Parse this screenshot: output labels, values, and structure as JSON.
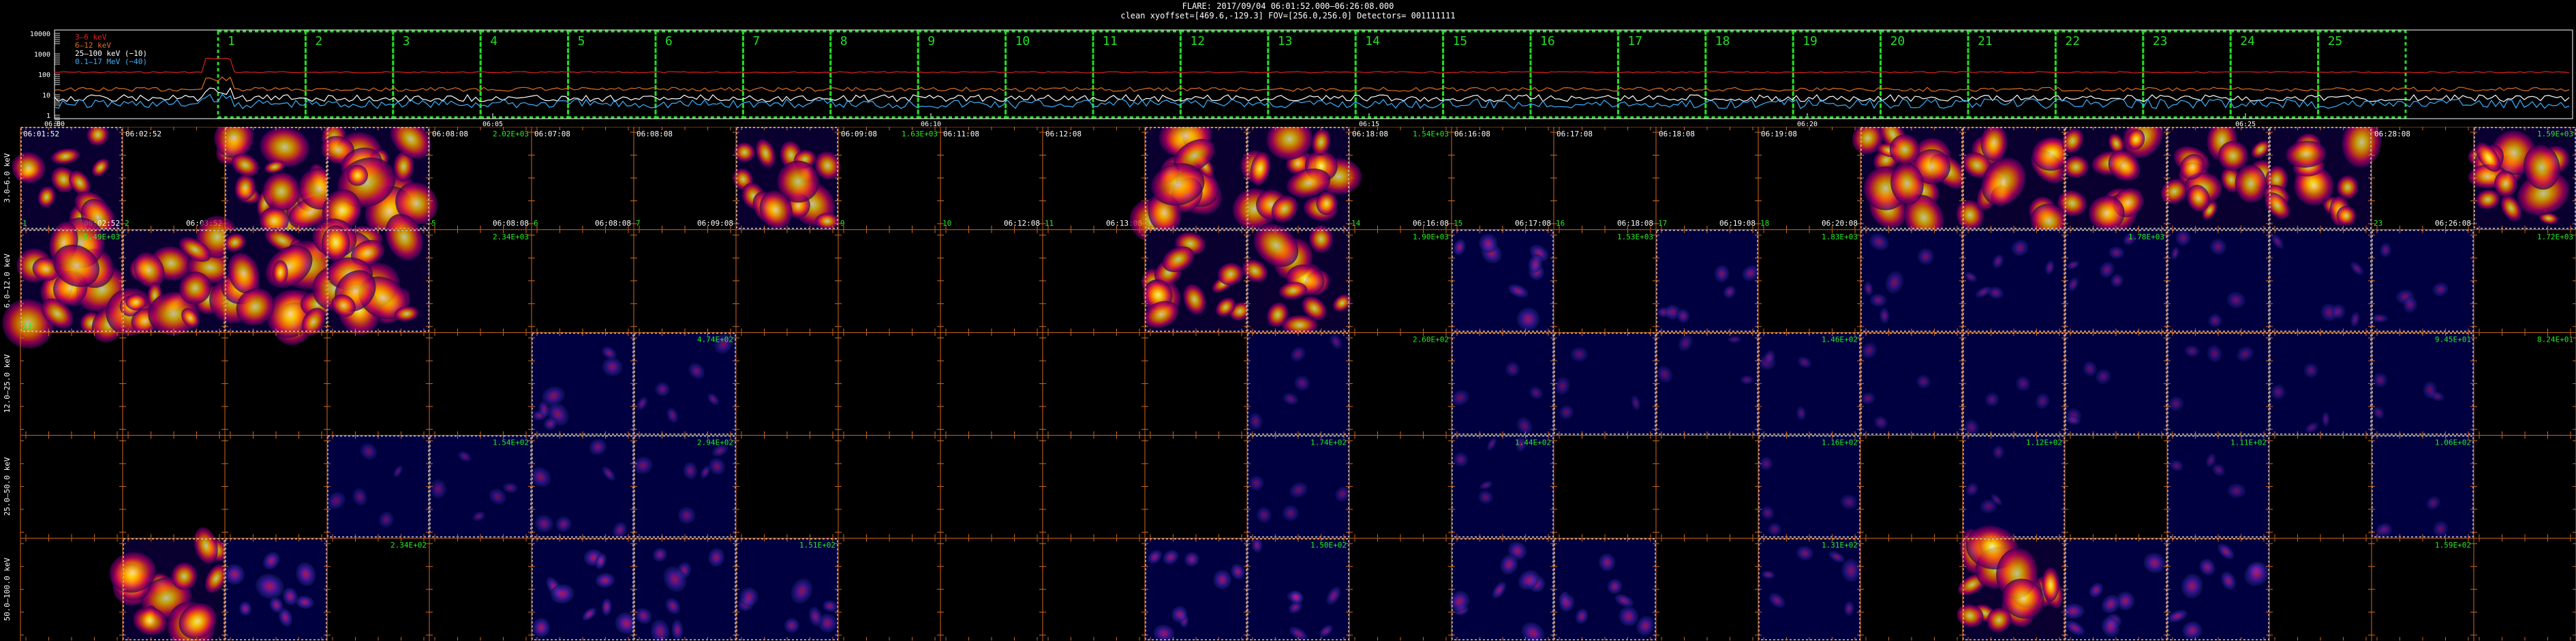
{
  "header": {
    "line1": "FLARE: 2017/09/04 06:01:52.000–06:26:08.000",
    "line2": "clean   xyoffset=[469.6,-129.3]   FOV=[256.0,256.0]   Detectors= 001111111"
  },
  "lightcurve": {
    "yticks": [
      "10000",
      "1000",
      "100",
      "10",
      "1"
    ],
    "xticks": [
      "06:00",
      "06:05",
      "06:10",
      "06:15",
      "06:20",
      "06:25"
    ],
    "legend": [
      {
        "text": "3–6 keV",
        "color": "#e02020"
      },
      {
        "text": "6–12 keV",
        "color": "#e07020"
      },
      {
        "text": "25–100 keV (−10)",
        "color": "#ffffff"
      },
      {
        "text": "0.1–17 MeV (−40)",
        "color": "#3ab0ff"
      }
    ],
    "intervals": [
      "1",
      "2",
      "3",
      "4",
      "5",
      "6",
      "7",
      "8",
      "9",
      "10",
      "11",
      "12",
      "13",
      "14",
      "15",
      "16",
      "17",
      "18",
      "19",
      "20",
      "21",
      "22",
      "23",
      "24",
      "25"
    ]
  },
  "grid": {
    "rows": [
      {
        "label": "3.0–6.0 keV",
        "cells": [
          {
            "img": "fire",
            "tl": "06:01:52",
            "br": "06:02:52",
            "bl": "1"
          },
          {
            "img": "none",
            "tl": "06:02:52",
            "br": "06:03:52",
            "bl": "2"
          },
          {
            "img": "fire",
            "intensity": 1.0,
            "bl": ""
          },
          {
            "img": "fire",
            "intensity": 0.9,
            "bl": ""
          },
          {
            "img": "none",
            "tl": "06:08:08",
            "tr": "2.02E+03",
            "br": "06:08:08",
            "bl": "5"
          },
          {
            "img": "none",
            "tl": "06:07:08",
            "br": "06:08:08",
            "bl": "6"
          },
          {
            "img": "none",
            "tl": "06:08:08",
            "br": "06:09:08",
            "bl": "7"
          },
          {
            "img": "fire",
            "intensity": 0.8,
            "bl": ""
          },
          {
            "img": "none",
            "tl": "06:09:08",
            "tr": "1.63E+03",
            "bl": "9"
          },
          {
            "img": "none",
            "tl": "06:11:08",
            "br": "06:12:08",
            "bl": "10"
          },
          {
            "img": "none",
            "tl": "06:12:08",
            "br": "06:13:08",
            "bl": "11"
          },
          {
            "img": "fire",
            "intensity": 0.85,
            "bl": ""
          },
          {
            "img": "fire",
            "intensity": 0.85,
            "bl": ""
          },
          {
            "img": "none",
            "tl": "06:18:08",
            "tr": "1.54E+03",
            "br": "06:16:08",
            "bl": "14"
          },
          {
            "img": "none",
            "tl": "06:16:08",
            "br": "06:17:08",
            "bl": "15"
          },
          {
            "img": "none",
            "tl": "06:17:08",
            "br": "06:18:08",
            "bl": "16"
          },
          {
            "img": "none",
            "tl": "06:18:08",
            "br": "06:19:08",
            "bl": "17"
          },
          {
            "img": "none",
            "tl": "06:19:08",
            "br": "06:20:08",
            "bl": "18"
          },
          {
            "img": "fire",
            "intensity": 0.8,
            "bl": ""
          },
          {
            "img": "fire",
            "intensity": 0.7,
            "bl": ""
          },
          {
            "img": "fire",
            "intensity": 0.7,
            "bl": ""
          },
          {
            "img": "fire",
            "intensity": 0.7,
            "bl": ""
          },
          {
            "img": "fire",
            "intensity": 0.7,
            "bl": ""
          },
          {
            "img": "none",
            "tl": "06:28:08",
            "br": "06:26:08",
            "bl": "23"
          },
          {
            "img": "fire",
            "intensity": 0.8,
            "tr": "1.59E+03",
            "bl": ""
          }
        ]
      },
      {
        "label": "6.0–12.0 keV",
        "cells": [
          {
            "img": "fire",
            "intensity": 1.0,
            "tr": "5.49E+03",
            "bl": "23"
          },
          {
            "img": "fire",
            "intensity": 1.0,
            "bl": ""
          },
          {
            "img": "fire",
            "intensity": 1.0,
            "bl": ""
          },
          {
            "img": "fire",
            "intensity": 1.0,
            "bl": ""
          },
          {
            "img": "none",
            "tr": "2.34E+03"
          },
          {
            "img": "none"
          },
          {
            "img": "none"
          },
          {
            "img": "none"
          },
          {
            "img": "none"
          },
          {
            "img": "none"
          },
          {
            "img": "none"
          },
          {
            "img": "fire",
            "intensity": 0.6
          },
          {
            "img": "fire",
            "intensity": 0.6
          },
          {
            "img": "none",
            "tr": "1.90E+03"
          },
          {
            "img": "dim",
            "intensity": 0.5
          },
          {
            "img": "none",
            "tr": "1.53E+03"
          },
          {
            "img": "dim",
            "intensity": 0.3
          },
          {
            "img": "none",
            "tr": "1.83E+03"
          },
          {
            "img": "dim",
            "intensity": 0.25
          },
          {
            "img": "dim",
            "intensity": 0.25
          },
          {
            "img": "dim",
            "intensity": 0.25,
            "tr": "1.78E+03"
          },
          {
            "img": "dim",
            "intensity": 0.2
          },
          {
            "img": "dim",
            "intensity": 0.2
          },
          {
            "img": "dim",
            "intensity": 0.2
          },
          {
            "img": "none",
            "tr": "1.72E+03"
          }
        ]
      },
      {
        "label": "12.0–25.0 keV",
        "cells": [
          {
            "img": "none"
          },
          {
            "img": "none"
          },
          {
            "img": "none"
          },
          {
            "img": "none"
          },
          {
            "img": "none"
          },
          {
            "img": "dim",
            "intensity": 0.35
          },
          {
            "img": "dim",
            "intensity": 0.25,
            "tr": "4.74E+02"
          },
          {
            "img": "none"
          },
          {
            "img": "none"
          },
          {
            "img": "none"
          },
          {
            "img": "none"
          },
          {
            "img": "none"
          },
          {
            "img": "dim",
            "intensity": 0.15
          },
          {
            "img": "none",
            "tr": "2.60E+02"
          },
          {
            "img": "dim",
            "intensity": 0.1
          },
          {
            "img": "dim",
            "intensity": 0.1
          },
          {
            "img": "dim",
            "intensity": 0.1
          },
          {
            "img": "dim",
            "intensity": 0.1,
            "tr": "1.46E+02"
          },
          {
            "img": "dim",
            "intensity": 0.1
          },
          {
            "img": "dim",
            "intensity": 0.1
          },
          {
            "img": "dim",
            "intensity": 0.1
          },
          {
            "img": "dim",
            "intensity": 0.1
          },
          {
            "img": "dim",
            "intensity": 0.1
          },
          {
            "img": "dim",
            "intensity": 0.1,
            "tr": "9.45E+01"
          },
          {
            "img": "none",
            "tr": "8.24E+01"
          }
        ]
      },
      {
        "label": "25.0–50.0 keV",
        "cells": [
          {
            "img": "none"
          },
          {
            "img": "none"
          },
          {
            "img": "none"
          },
          {
            "img": "dim",
            "intensity": 0.15
          },
          {
            "img": "dim",
            "intensity": 0.15,
            "tr": "1.54E+02"
          },
          {
            "img": "dim",
            "intensity": 0.3
          },
          {
            "img": "dim",
            "intensity": 0.25,
            "tr": "2.94E+02"
          },
          {
            "img": "none"
          },
          {
            "img": "none"
          },
          {
            "img": "none"
          },
          {
            "img": "none"
          },
          {
            "img": "none"
          },
          {
            "img": "dim",
            "intensity": 0.15,
            "tr": "1.74E+02"
          },
          {
            "img": "none"
          },
          {
            "img": "dim",
            "intensity": 0.15,
            "tr": "1.44E+02"
          },
          {
            "img": "none"
          },
          {
            "img": "none"
          },
          {
            "img": "dim",
            "intensity": 0.1,
            "tr": "1.16E+02"
          },
          {
            "img": "none"
          },
          {
            "img": "dim",
            "intensity": 0.1,
            "tr": "1.12E+02"
          },
          {
            "img": "none"
          },
          {
            "img": "dim",
            "intensity": 0.1,
            "tr": "1.11E+02"
          },
          {
            "img": "none"
          },
          {
            "img": "dim",
            "intensity": 0.1,
            "tr": "1.06E+02"
          },
          {
            "img": "none"
          }
        ]
      },
      {
        "label": "50.0–100.0 keV",
        "cells": [
          {
            "img": "none"
          },
          {
            "img": "fire",
            "intensity": 0.9
          },
          {
            "img": "dim",
            "intensity": 0.6
          },
          {
            "img": "none",
            "tr": "2.34E+02"
          },
          {
            "img": "none"
          },
          {
            "img": "dim",
            "intensity": 0.6
          },
          {
            "img": "dim",
            "intensity": 0.45
          },
          {
            "img": "dim",
            "intensity": 0.4,
            "tr": "1.51E+02"
          },
          {
            "img": "none"
          },
          {
            "img": "none"
          },
          {
            "img": "none"
          },
          {
            "img": "dim",
            "intensity": 0.5
          },
          {
            "img": "dim",
            "intensity": 0.4,
            "tr": "1.50E+02"
          },
          {
            "img": "none"
          },
          {
            "img": "dim",
            "intensity": 0.5
          },
          {
            "img": "dim",
            "intensity": 0.45
          },
          {
            "img": "none"
          },
          {
            "img": "dim",
            "intensity": 0.3,
            "tr": "1.31E+02"
          },
          {
            "img": "none"
          },
          {
            "img": "fire",
            "intensity": 0.85
          },
          {
            "img": "dim",
            "intensity": 0.5
          },
          {
            "img": "dim",
            "intensity": 0.5
          },
          {
            "img": "none"
          },
          {
            "img": "none",
            "tr": "1.59E+02"
          },
          {
            "img": "none"
          }
        ]
      }
    ]
  },
  "colors": {
    "intervalBox": "#22dd22",
    "gridLine": "#d2691e",
    "imgBorder": "#cccccc",
    "annotation": "#22ee22",
    "timeText": "#ffffff"
  }
}
